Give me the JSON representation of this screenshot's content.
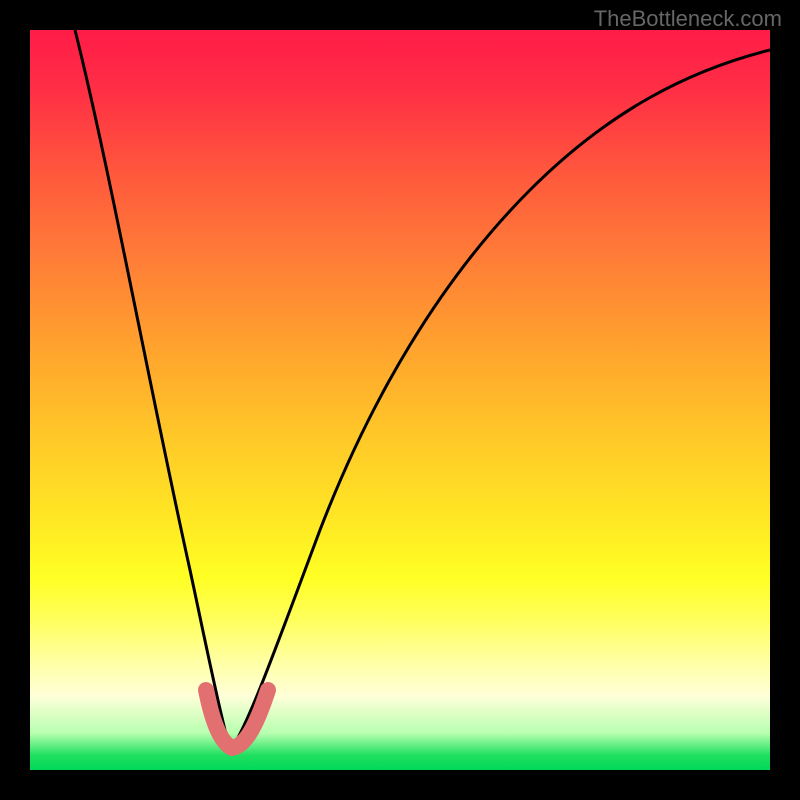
{
  "watermark": "TheBottleneck.com",
  "chart_data": {
    "type": "line",
    "title": "",
    "xlabel": "",
    "ylabel": "",
    "xlim": [
      0,
      100
    ],
    "ylim": [
      0,
      100
    ],
    "note": "V-shaped bottleneck curve over vertical gradient (red=high, green=low). Minimum near x≈27. Pink thick overlay segment marks the bottom of the V between x≈24 and x≈32.",
    "series": [
      {
        "name": "left-branch",
        "x": [
          6,
          10,
          14,
          18,
          22,
          24,
          26,
          27
        ],
        "values": [
          100,
          80,
          58,
          37,
          17,
          9,
          4,
          3
        ]
      },
      {
        "name": "right-branch",
        "x": [
          27,
          30,
          34,
          40,
          48,
          58,
          70,
          84,
          100
        ],
        "values": [
          3,
          7,
          18,
          34,
          51,
          66,
          78,
          87,
          93
        ]
      },
      {
        "name": "valley-highlight",
        "x": [
          24,
          26,
          27,
          28,
          30,
          32
        ],
        "values": [
          9,
          4,
          3,
          3.5,
          7,
          12
        ]
      }
    ],
    "gradient_stops": [
      {
        "pct": 0,
        "color": "#ff1c47"
      },
      {
        "pct": 30,
        "color": "#ff7a38"
      },
      {
        "pct": 65,
        "color": "#ffe424"
      },
      {
        "pct": 90,
        "color": "#ffffd8"
      },
      {
        "pct": 100,
        "color": "#00d858"
      }
    ]
  }
}
